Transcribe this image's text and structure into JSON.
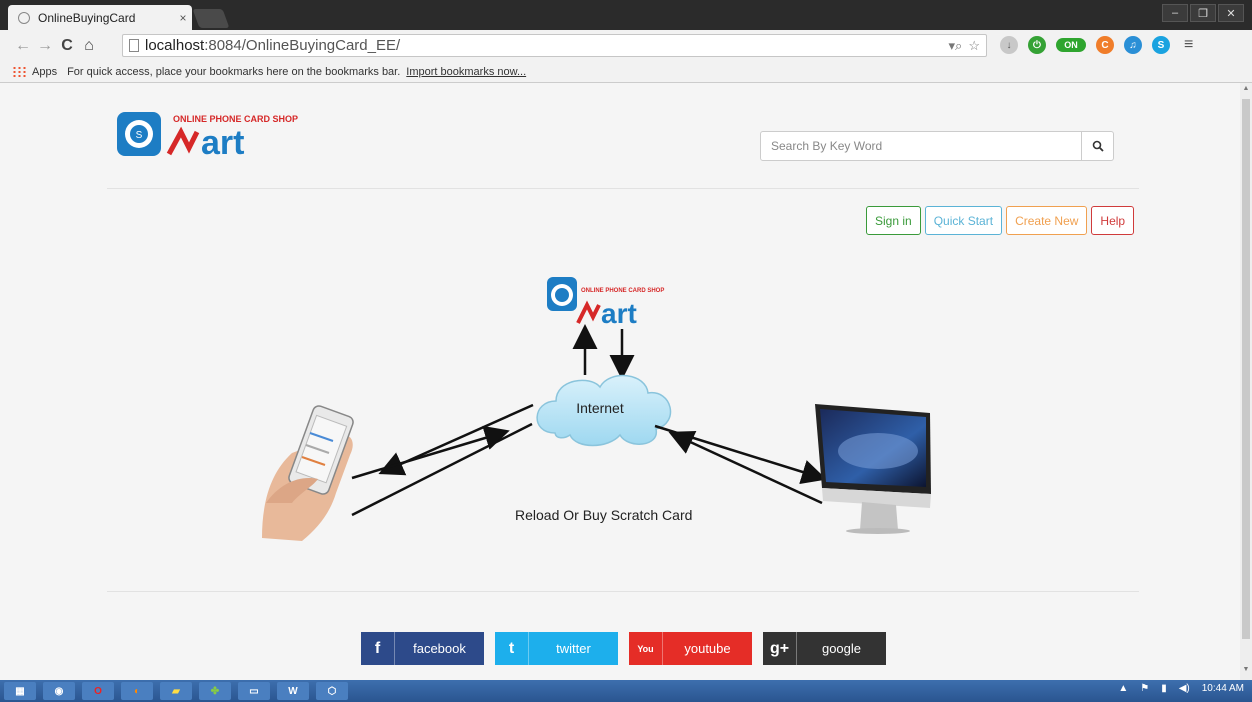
{
  "browser": {
    "tab_title": "OnlineBuyingCard",
    "tab_close": "×",
    "url_host": "localhost",
    "url_path": ":8084/OnlineBuyingCard_EE/",
    "ext_on_label": "ON",
    "bookmarks_bar": {
      "apps": "Apps",
      "hint": "For quick access, place your bookmarks here on the bookmarks bar.",
      "import": "Import bookmarks now..."
    }
  },
  "header": {
    "logo_text": "ONLINE PHONE CARD SHOP",
    "logo_word": "art",
    "search_placeholder": "Search By Key Word"
  },
  "actions": {
    "sign_in": "Sign in",
    "quick_start": "Quick Start",
    "create_new": "Create New",
    "help": "Help"
  },
  "diagram": {
    "cloud_label": "Internet",
    "caption": "Reload Or Buy Scratch Card",
    "logo_text": "ONLINE PHONE CARD SHOP",
    "logo_word": "art"
  },
  "social": [
    {
      "icon": "f",
      "label": "facebook",
      "color": "#2d4a8a"
    },
    {
      "icon": "t",
      "label": "twitter",
      "color": "#1dafec"
    },
    {
      "icon": "You",
      "label": "youtube",
      "color": "#e52d27"
    },
    {
      "icon": "g+",
      "label": "google",
      "color": "#333333"
    }
  ],
  "taskbar": {
    "word_icon": "W",
    "clock": "10:44 AM"
  },
  "colors": {
    "brand_blue": "#1d7dc4",
    "brand_red": "#d62828"
  }
}
